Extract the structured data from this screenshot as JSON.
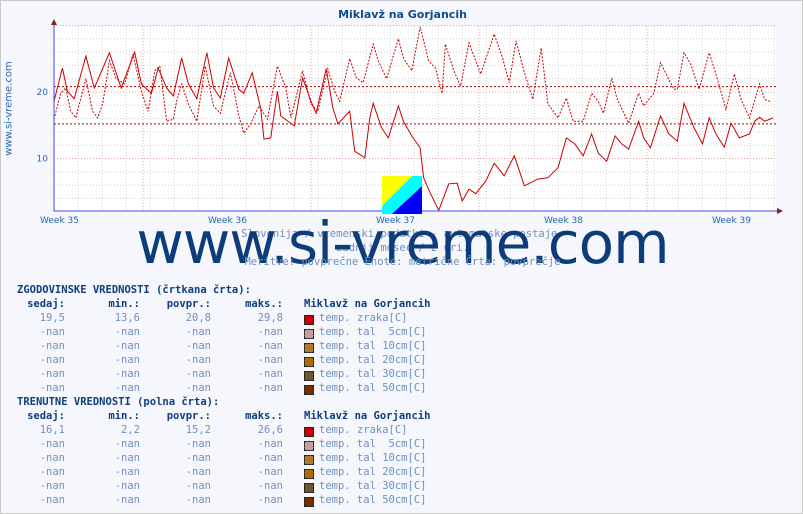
{
  "title": "Miklavž na Gorjancih",
  "side_label": "www.si-vreme.com",
  "watermark": "www.si-vreme.com",
  "captions": [
    "Slovenija / vremenski podatki - avtomatske postaje.",
    "zadnji mesec / 2 uri.",
    "Meritve: povprečne  Enote: metrične  Črta: povprečje"
  ],
  "chart_data": {
    "type": "line",
    "x_ticks": [
      "Week 35",
      "Week 36",
      "Week 37",
      "Week 38",
      "Week 39"
    ],
    "x_tick_values": [
      35,
      36,
      37,
      38,
      39
    ],
    "y_ticks": [
      10,
      20
    ],
    "ylim": [
      2.1,
      30
    ],
    "xlim": [
      35,
      39.3
    ],
    "grid": true,
    "reference_lines": [
      20.8,
      15.2
    ],
    "series": [
      {
        "name": "temp. zraka[C] (zgodovinske, črtkana)",
        "color": "#cc0000",
        "style": "dashed",
        "points": [
          [
            35.0,
            15.9
          ],
          [
            35.04,
            19.8
          ],
          [
            35.07,
            20.6
          ],
          [
            35.1,
            17.1
          ],
          [
            35.13,
            16.1
          ],
          [
            35.19,
            22.0
          ],
          [
            35.23,
            17.1
          ],
          [
            35.26,
            16.1
          ],
          [
            35.29,
            18.2
          ],
          [
            35.33,
            24.7
          ],
          [
            35.37,
            22.0
          ],
          [
            35.42,
            21.2
          ],
          [
            35.47,
            25.7
          ],
          [
            35.52,
            20.1
          ],
          [
            35.56,
            17.1
          ],
          [
            35.6,
            23.2
          ],
          [
            35.63,
            23.9
          ],
          [
            35.67,
            15.6
          ],
          [
            35.71,
            15.9
          ],
          [
            35.73,
            18.6
          ],
          [
            35.76,
            21.2
          ],
          [
            35.8,
            18.2
          ],
          [
            35.85,
            15.6
          ],
          [
            35.9,
            23.9
          ],
          [
            35.95,
            17.9
          ],
          [
            35.99,
            16.8
          ],
          [
            36.05,
            22.9
          ],
          [
            36.1,
            16.4
          ],
          [
            36.13,
            13.8
          ],
          [
            36.17,
            15.2
          ],
          [
            36.22,
            17.9
          ],
          [
            36.27,
            15.9
          ],
          [
            36.33,
            23.9
          ],
          [
            36.38,
            20.6
          ],
          [
            36.41,
            16.1
          ],
          [
            36.48,
            23.2
          ],
          [
            36.53,
            18.2
          ],
          [
            36.57,
            17.1
          ],
          [
            36.63,
            23.5
          ],
          [
            36.67,
            20.1
          ],
          [
            36.7,
            18.6
          ],
          [
            36.76,
            25.0
          ],
          [
            36.8,
            22.1
          ],
          [
            36.84,
            21.4
          ],
          [
            36.9,
            27.2
          ],
          [
            36.93,
            24.7
          ],
          [
            36.98,
            22.0
          ],
          [
            37.05,
            28.0
          ],
          [
            37.08,
            25.1
          ],
          [
            37.13,
            23.2
          ],
          [
            37.18,
            29.8
          ],
          [
            37.23,
            24.7
          ],
          [
            37.27,
            23.6
          ],
          [
            37.31,
            19.8
          ],
          [
            37.33,
            27.2
          ],
          [
            37.38,
            23.2
          ],
          [
            37.42,
            20.9
          ],
          [
            37.47,
            27.4
          ],
          [
            37.54,
            22.7
          ],
          [
            37.62,
            28.7
          ],
          [
            37.67,
            25.1
          ],
          [
            37.71,
            21.4
          ],
          [
            37.75,
            27.7
          ],
          [
            37.8,
            22.9
          ],
          [
            37.85,
            18.9
          ],
          [
            37.9,
            26.6
          ],
          [
            37.94,
            18.2
          ],
          [
            38.0,
            16.1
          ],
          [
            38.05,
            19.1
          ],
          [
            38.09,
            15.6
          ],
          [
            38.15,
            15.6
          ],
          [
            38.2,
            19.8
          ],
          [
            38.24,
            18.6
          ],
          [
            38.27,
            16.8
          ],
          [
            38.32,
            22.1
          ],
          [
            38.35,
            19.1
          ],
          [
            38.42,
            15.3
          ],
          [
            38.48,
            19.8
          ],
          [
            38.51,
            17.9
          ],
          [
            38.57,
            19.8
          ],
          [
            38.61,
            24.4
          ],
          [
            38.69,
            20.4
          ],
          [
            38.71,
            20.4
          ],
          [
            38.75,
            25.9
          ],
          [
            38.79,
            24.2
          ],
          [
            38.84,
            20.4
          ],
          [
            38.9,
            25.9
          ],
          [
            38.94,
            22.7
          ],
          [
            39.0,
            17.4
          ],
          [
            39.05,
            22.7
          ],
          [
            39.09,
            18.9
          ],
          [
            39.14,
            16.1
          ],
          [
            39.2,
            21.2
          ],
          [
            39.23,
            18.9
          ],
          [
            39.27,
            18.5
          ]
        ]
      },
      {
        "name": "temp. zraka[C] (trenutne, polna)",
        "color": "#cc0000",
        "style": "solid",
        "points": [
          [
            35.0,
            18.6
          ],
          [
            35.05,
            23.6
          ],
          [
            35.08,
            20.1
          ],
          [
            35.12,
            19.0
          ],
          [
            35.19,
            25.4
          ],
          [
            35.24,
            20.6
          ],
          [
            35.33,
            25.9
          ],
          [
            35.4,
            20.6
          ],
          [
            35.48,
            26.0
          ],
          [
            35.52,
            21.2
          ],
          [
            35.58,
            19.8
          ],
          [
            35.62,
            23.6
          ],
          [
            35.67,
            20.6
          ],
          [
            35.71,
            19.4
          ],
          [
            35.76,
            25.1
          ],
          [
            35.8,
            21.2
          ],
          [
            35.85,
            19.0
          ],
          [
            35.91,
            25.9
          ],
          [
            35.95,
            20.6
          ],
          [
            35.99,
            19.1
          ],
          [
            36.04,
            25.1
          ],
          [
            36.1,
            20.4
          ],
          [
            36.13,
            19.8
          ],
          [
            36.18,
            22.9
          ],
          [
            36.23,
            17.6
          ],
          [
            36.25,
            12.9
          ],
          [
            36.29,
            13.1
          ],
          [
            36.33,
            20.1
          ],
          [
            36.35,
            16.4
          ],
          [
            36.43,
            14.9
          ],
          [
            36.48,
            22.1
          ],
          [
            36.53,
            18.6
          ],
          [
            36.56,
            16.8
          ],
          [
            36.62,
            23.5
          ],
          [
            36.66,
            17.6
          ],
          [
            36.69,
            15.2
          ],
          [
            36.76,
            17.1
          ],
          [
            36.79,
            11.1
          ],
          [
            36.85,
            10.1
          ],
          [
            36.88,
            16.1
          ],
          [
            36.9,
            18.3
          ],
          [
            36.95,
            14.6
          ],
          [
            36.99,
            13.1
          ],
          [
            37.05,
            17.9
          ],
          [
            37.08,
            15.6
          ],
          [
            37.13,
            13.4
          ],
          [
            37.18,
            11.6
          ],
          [
            37.2,
            7.1
          ],
          [
            37.24,
            4.8
          ],
          [
            37.29,
            2.2
          ],
          [
            37.35,
            6.2
          ],
          [
            37.4,
            6.3
          ],
          [
            37.43,
            3.6
          ],
          [
            37.47,
            5.4
          ],
          [
            37.51,
            4.7
          ],
          [
            37.57,
            6.6
          ],
          [
            37.62,
            9.3
          ],
          [
            37.68,
            7.4
          ],
          [
            37.74,
            10.4
          ],
          [
            37.8,
            5.9
          ],
          [
            37.88,
            6.9
          ],
          [
            37.94,
            7.1
          ],
          [
            38.0,
            8.6
          ],
          [
            38.05,
            13.1
          ],
          [
            38.1,
            12.2
          ],
          [
            38.15,
            10.4
          ],
          [
            38.2,
            13.7
          ],
          [
            38.24,
            10.8
          ],
          [
            38.29,
            9.6
          ],
          [
            38.34,
            13.4
          ],
          [
            38.38,
            12.2
          ],
          [
            38.42,
            11.4
          ],
          [
            38.48,
            15.6
          ],
          [
            38.51,
            13.1
          ],
          [
            38.55,
            11.6
          ],
          [
            38.61,
            16.4
          ],
          [
            38.66,
            13.7
          ],
          [
            38.71,
            12.6
          ],
          [
            38.75,
            18.3
          ],
          [
            38.81,
            14.6
          ],
          [
            38.86,
            12.2
          ],
          [
            38.9,
            16.1
          ],
          [
            38.94,
            13.7
          ],
          [
            38.99,
            11.7
          ],
          [
            39.03,
            15.3
          ],
          [
            39.08,
            13.1
          ],
          [
            39.14,
            13.7
          ],
          [
            39.17,
            15.6
          ],
          [
            39.2,
            16.2
          ],
          [
            39.23,
            15.6
          ],
          [
            39.28,
            16.1
          ]
        ]
      }
    ]
  },
  "tables": [
    {
      "heading": "ZGODOVINSKE VREDNOSTI (črtkana črta):",
      "cols": [
        "sedaj:",
        "min.:",
        "povpr.:",
        "maks.:"
      ],
      "station": "Miklavž na Gorjancih",
      "rows": [
        {
          "v": [
            "19,5",
            "13,6",
            "20,8",
            "29,8"
          ],
          "label": "temp. zraka[C]",
          "color": "#cc0000"
        },
        {
          "v": [
            "-nan",
            "-nan",
            "-nan",
            "-nan"
          ],
          "label": "temp. tal  5cm[C]",
          "color": "#c4a09c"
        },
        {
          "v": [
            "-nan",
            "-nan",
            "-nan",
            "-nan"
          ],
          "label": "temp. tal 10cm[C]",
          "color": "#b07830"
        },
        {
          "v": [
            "-nan",
            "-nan",
            "-nan",
            "-nan"
          ],
          "label": "temp. tal 20cm[C]",
          "color": "#a86e00"
        },
        {
          "v": [
            "-nan",
            "-nan",
            "-nan",
            "-nan"
          ],
          "label": "temp. tal 30cm[C]",
          "color": "#685830"
        },
        {
          "v": [
            "-nan",
            "-nan",
            "-nan",
            "-nan"
          ],
          "label": "temp. tal 50cm[C]",
          "color": "#703000"
        }
      ]
    },
    {
      "heading": "TRENUTNE VREDNOSTI (polna črta):",
      "cols": [
        "sedaj:",
        "min.:",
        "povpr.:",
        "maks.:"
      ],
      "station": "Miklavž na Gorjancih",
      "rows": [
        {
          "v": [
            "16,1",
            "2,2",
            "15,2",
            "26,6"
          ],
          "label": "temp. zraka[C]",
          "color": "#cc0000"
        },
        {
          "v": [
            "-nan",
            "-nan",
            "-nan",
            "-nan"
          ],
          "label": "temp. tal  5cm[C]",
          "color": "#c4a09c"
        },
        {
          "v": [
            "-nan",
            "-nan",
            "-nan",
            "-nan"
          ],
          "label": "temp. tal 10cm[C]",
          "color": "#b07830"
        },
        {
          "v": [
            "-nan",
            "-nan",
            "-nan",
            "-nan"
          ],
          "label": "temp. tal 20cm[C]",
          "color": "#a86e00"
        },
        {
          "v": [
            "-nan",
            "-nan",
            "-nan",
            "-nan"
          ],
          "label": "temp. tal 30cm[C]",
          "color": "#685830"
        },
        {
          "v": [
            "-nan",
            "-nan",
            "-nan",
            "-nan"
          ],
          "label": "temp. tal 50cm[C]",
          "color": "#703000"
        }
      ]
    }
  ]
}
